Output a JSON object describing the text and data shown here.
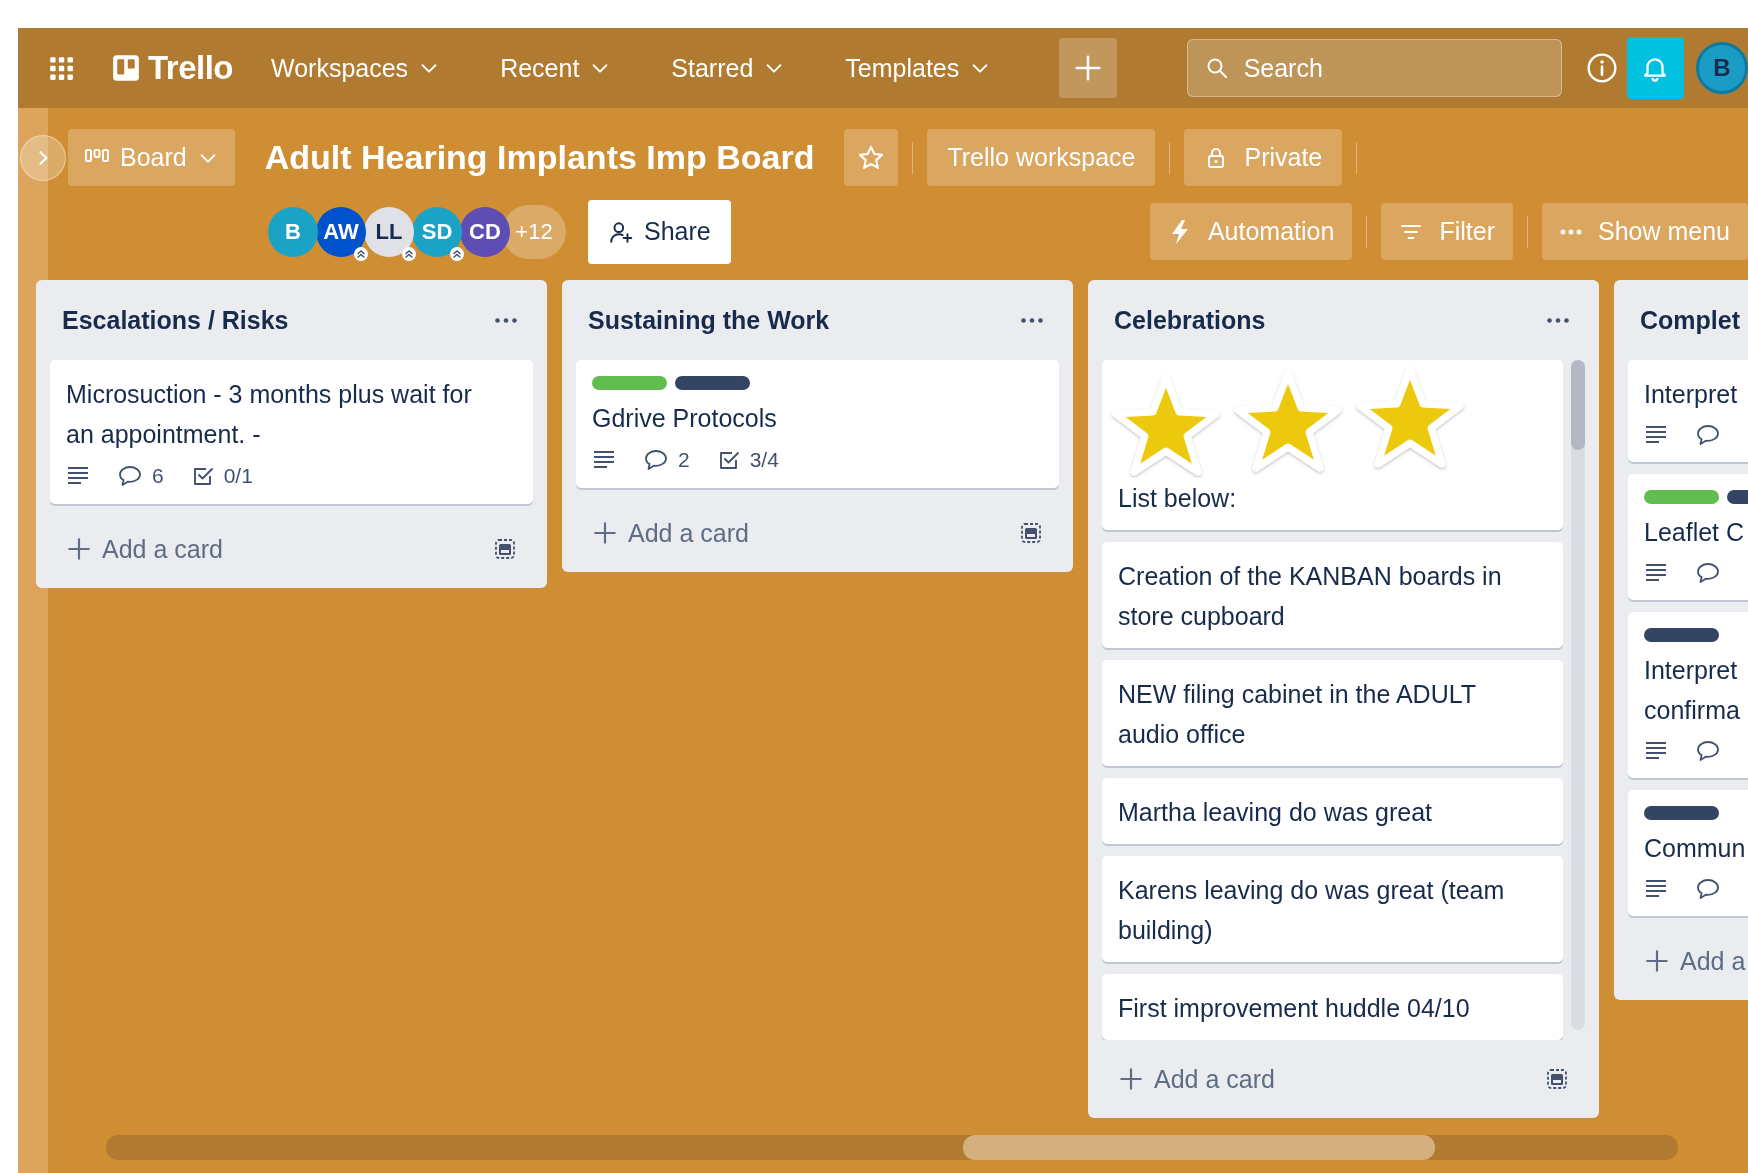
{
  "top_nav": {
    "logo": "Trello",
    "menus": [
      {
        "label": "Workspaces"
      },
      {
        "label": "Recent"
      },
      {
        "label": "Starred"
      },
      {
        "label": "Templates"
      }
    ],
    "search": {
      "placeholder": "Search"
    },
    "account": {
      "initials": "B"
    }
  },
  "board_header": {
    "view_switcher": "Board",
    "title": "Adult Hearing Implants Imp Board",
    "starred": false,
    "workspace": "Trello workspace",
    "visibility": "Private",
    "members": [
      {
        "initials": "B",
        "color": "#1ba3c6",
        "admin": false
      },
      {
        "initials": "AW",
        "color": "#0052cc",
        "admin": true
      },
      {
        "initials": "LL",
        "color": "#dfe1e6",
        "admin": true
      },
      {
        "initials": "SD",
        "color": "#1ba3c6",
        "admin": true
      },
      {
        "initials": "CD",
        "color": "#5e4db2",
        "admin": false
      }
    ],
    "more_members": "+12",
    "share": "Share",
    "actions": [
      {
        "kind": "automation",
        "label": "Automation"
      },
      {
        "kind": "filter",
        "label": "Filter"
      },
      {
        "kind": "menu",
        "label": "Show menu"
      }
    ]
  },
  "lists": [
    {
      "title": "Escalations / Risks",
      "scrollable": false,
      "add_card": "Add a card",
      "cards": [
        {
          "kind": "text",
          "text": "Microsuction - 3 months plus wait for an appointment. -",
          "badges": [
            {
              "kind": "description"
            },
            {
              "kind": "comments",
              "text": "6"
            },
            {
              "kind": "checklist",
              "text": "0/1"
            }
          ]
        }
      ]
    },
    {
      "title": "Sustaining the Work",
      "scrollable": false,
      "add_card": "Add a card",
      "cards": [
        {
          "kind": "text",
          "labels": [
            {
              "color": "#61bd4f"
            },
            {
              "color": "#344563"
            }
          ],
          "text": "Gdrive Protocols",
          "badges": [
            {
              "kind": "description"
            },
            {
              "kind": "comments",
              "text": "2"
            },
            {
              "kind": "checklist",
              "text": "3/4"
            }
          ]
        }
      ]
    },
    {
      "title": "Celebrations",
      "scrollable": true,
      "add_card": "Add a card",
      "cards": [
        {
          "kind": "cover",
          "text": "List below:"
        },
        {
          "kind": "text",
          "text": "Creation of the KANBAN boards in store cupboard"
        },
        {
          "kind": "text",
          "text": "NEW filing cabinet in the ADULT audio office"
        },
        {
          "kind": "text",
          "text": "Martha leaving do was great"
        },
        {
          "kind": "text",
          "text": "Karens leaving do was great (team building)"
        },
        {
          "kind": "text",
          "text": "First improvement huddle 04/10"
        }
      ]
    },
    {
      "title": "Complet",
      "scrollable": false,
      "add_card": "Add a",
      "cards": [
        {
          "kind": "text",
          "text": "Interpret",
          "badges": [
            {
              "kind": "description"
            },
            {
              "kind": "comments"
            }
          ]
        },
        {
          "kind": "text",
          "labels": [
            {
              "color": "#61bd4f"
            },
            {
              "color": "#344563"
            }
          ],
          "text": "Leaflet C",
          "badges": [
            {
              "kind": "description"
            },
            {
              "kind": "comments"
            }
          ]
        },
        {
          "kind": "text",
          "labels": [
            {
              "color": "#344563"
            }
          ],
          "text": "Interpret\nconfirma",
          "badges": [
            {
              "kind": "description"
            },
            {
              "kind": "comments"
            }
          ]
        },
        {
          "kind": "text",
          "labels": [
            {
              "color": "#344563"
            }
          ],
          "text": "Commun",
          "badges": [
            {
              "kind": "description"
            },
            {
              "kind": "comments"
            }
          ]
        }
      ]
    }
  ]
}
